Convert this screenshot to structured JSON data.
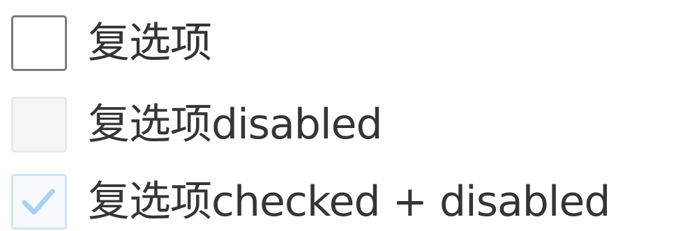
{
  "checkboxes": [
    {
      "label": "复选项",
      "checked": false,
      "disabled": false
    },
    {
      "label": "复选项disabled",
      "checked": false,
      "disabled": true
    },
    {
      "label": "复选项checked + disabled",
      "checked": true,
      "disabled": true
    }
  ],
  "colors": {
    "label_text": "#333333",
    "checkbox_border": "#7a7a7a",
    "checkmark": "#a9d2f5"
  }
}
